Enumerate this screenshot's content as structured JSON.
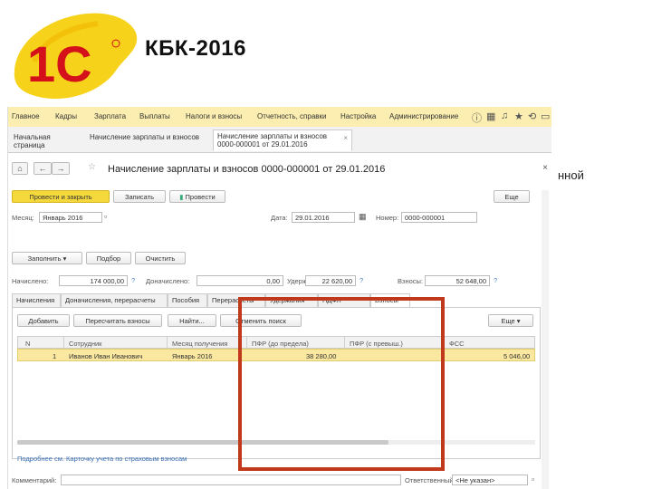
{
  "slide": {
    "title": "КБК-2016",
    "side_fragment": "нной",
    "logo_text": "1С"
  },
  "menu": {
    "items": [
      "Главное",
      "Кадры",
      "Зарплата",
      "Выплаты",
      "Налоги и взносы",
      "Отчетность, справки",
      "Настройка",
      "Администрирование"
    ]
  },
  "page_tabs": [
    {
      "label": "Начальная страница"
    },
    {
      "label": "Начисление зарплаты и взносов"
    },
    {
      "label": "Начисление зарплаты и взносов 0000-000001 от 29.01.2016",
      "line1": "Начисление зарплаты и взносов",
      "line2": "0000-000001 от 29.01.2016",
      "close": "×"
    }
  ],
  "document": {
    "title": "Начисление зарплаты и взносов 0000-000001 от 29.01.2016",
    "close": "×",
    "nav_back": "←",
    "nav_forward": "→",
    "home": "⌂"
  },
  "toolbar": {
    "post_close": "Провести и закрыть",
    "save": "Записать",
    "post": "Провести",
    "more": "Еще"
  },
  "header_fields": {
    "month_label": "Месяц:",
    "month_value": "Январь 2016",
    "date_label": "Дата:",
    "date_value": "29.01.2016",
    "number_label": "Номер:",
    "number_value": "0000-000001"
  },
  "action_buttons": {
    "fill": "Заполнить",
    "select": "Подбор",
    "clear": "Очистить"
  },
  "totals": {
    "accrued_label": "Начислено:",
    "accrued_value": "174 000,00",
    "withheld_extra_label": "Доначислено:",
    "withheld_extra_value": "0,00",
    "deducted_label": "Удержано:",
    "deducted_value": "22 620,00",
    "contrib_label": "Взносы:",
    "contrib_value": "52 648,00",
    "help": "?"
  },
  "inner_tabs": [
    "Начисления",
    "Доначисления, перерасчеты",
    "Пособия",
    "Перерасчеты",
    "Удержания",
    "НДФЛ",
    "Взносы"
  ],
  "grid_toolbar": {
    "add": "Добавить",
    "recalc": "Пересчитать взносы",
    "find": "Найти...",
    "cancel_search": "Отменить поиск",
    "more": "Еще"
  },
  "grid": {
    "columns": [
      "N",
      "Сотрудник",
      "Месяц получения",
      "ПФР (до предела)",
      "ПФР (с превыш.)",
      "ФСС"
    ],
    "rows": [
      [
        "1",
        "Иванов Иван Иванович",
        "Январь 2016",
        "38 280,00",
        "",
        "5 046,00"
      ]
    ]
  },
  "footer": {
    "link": "Подробнее см. Карточку учета по страховым взносам",
    "comment_label": "Комментарий:",
    "responsible_label": "Ответственный:",
    "responsible_value": "<Не указан>"
  }
}
